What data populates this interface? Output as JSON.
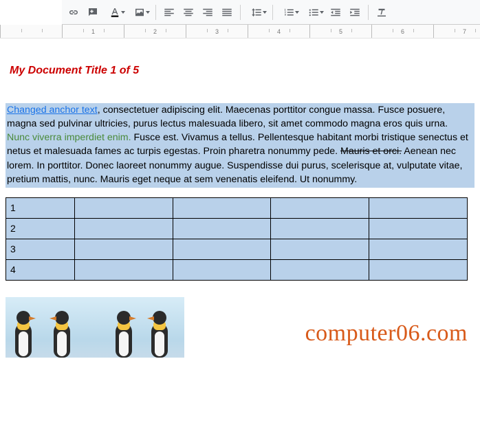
{
  "toolbar": {
    "link_icon": "link",
    "comment_icon": "comment",
    "image_icon": "image",
    "align_left": "align-left",
    "align_center": "align-center",
    "align_right": "align-right",
    "align_justify": "align-justify",
    "line_spacing": "line-spacing",
    "numbered_list": "numbered-list",
    "bulleted_list": "bulleted-list",
    "decrease_indent": "decrease-indent",
    "increase_indent": "increase-indent",
    "clear_formatting": "clear-formatting"
  },
  "ruler": {
    "units": [
      "",
      "1",
      "2",
      "3",
      "4",
      "5",
      "6",
      "7"
    ]
  },
  "title": "My Document Title 1 of 5",
  "body": {
    "anchor_text": "Changed anchor text",
    "seg1": ", consectetuer adipiscing elit. Maecenas porttitor congue massa. Fusce posuere, magna sed pulvinar ultricies, purus lectus malesuada libero, sit amet commodo magna eros quis urna. ",
    "green_text": "Nunc viverra imperdiet enim.",
    "seg2": " Fusce est. Vivamus a tellus. Pellentesque habitant morbi tristique senectus et netus et malesuada fames ac turpis egestas. Proin pharetra nonummy pede. ",
    "strike_text": "Mauris et orci.",
    "seg3": " Aenean nec lorem. In porttitor. Donec laoreet nonummy augue. Suspendisse dui purus, scelerisque at, vulputate vitae, pretium mattis, nunc. Mauris eget neque at sem venenatis eleifend. Ut nonummy."
  },
  "table": {
    "rows": [
      {
        "head": "1",
        "cells": [
          "",
          "",
          "",
          ""
        ]
      },
      {
        "head": "2",
        "cells": [
          "",
          "",
          "",
          ""
        ]
      },
      {
        "head": "3",
        "cells": [
          "",
          "",
          "",
          ""
        ]
      },
      {
        "head": "4",
        "cells": [
          "",
          "",
          "",
          ""
        ]
      }
    ]
  },
  "watermark": "computer06.com"
}
